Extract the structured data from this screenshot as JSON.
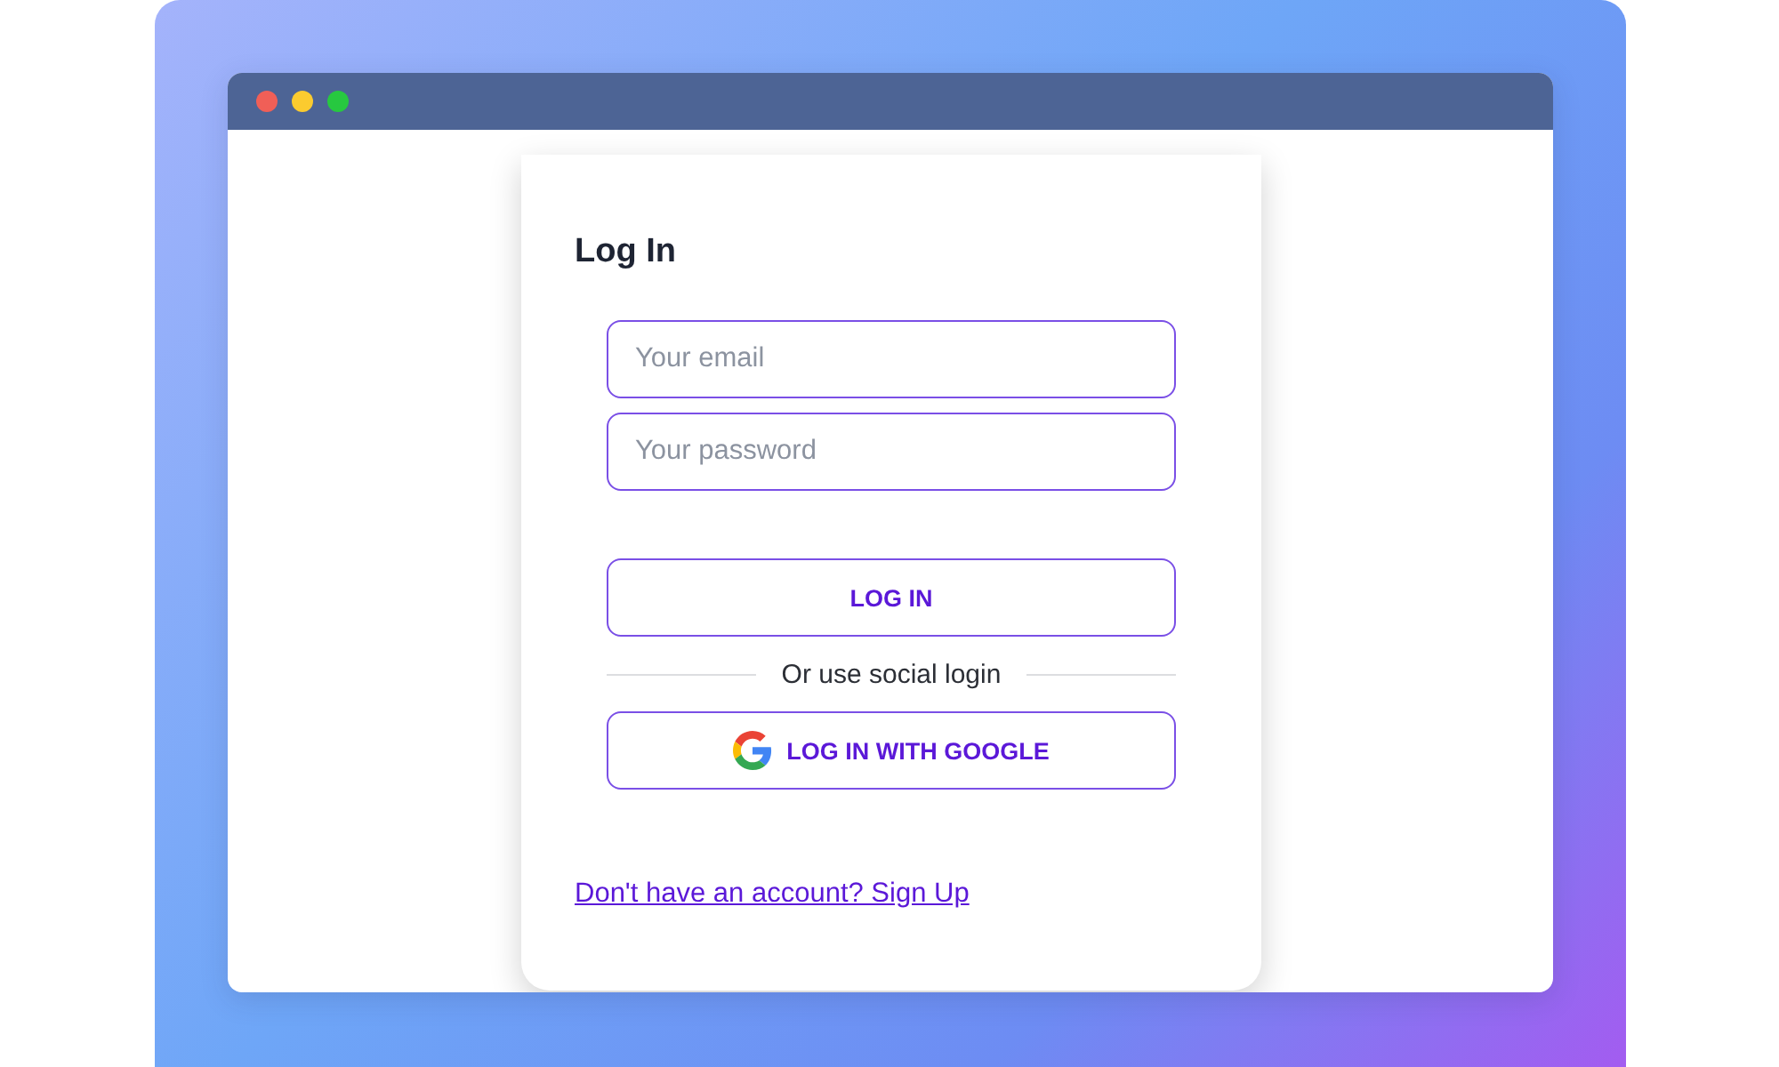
{
  "window": {
    "controls": [
      {
        "color": "#f05f57"
      },
      {
        "color": "#fbcb2f"
      },
      {
        "color": "#27c840"
      }
    ]
  },
  "login": {
    "title": "Log In",
    "fields": [
      {
        "placeholder": "Your email"
      },
      {
        "placeholder": "Your password"
      }
    ],
    "submit": "LOG IN",
    "divider": "Or use social login",
    "social_button": "LOG IN WITH GOOGLE",
    "signup_link": "Don't have an account? Sign Up"
  }
}
